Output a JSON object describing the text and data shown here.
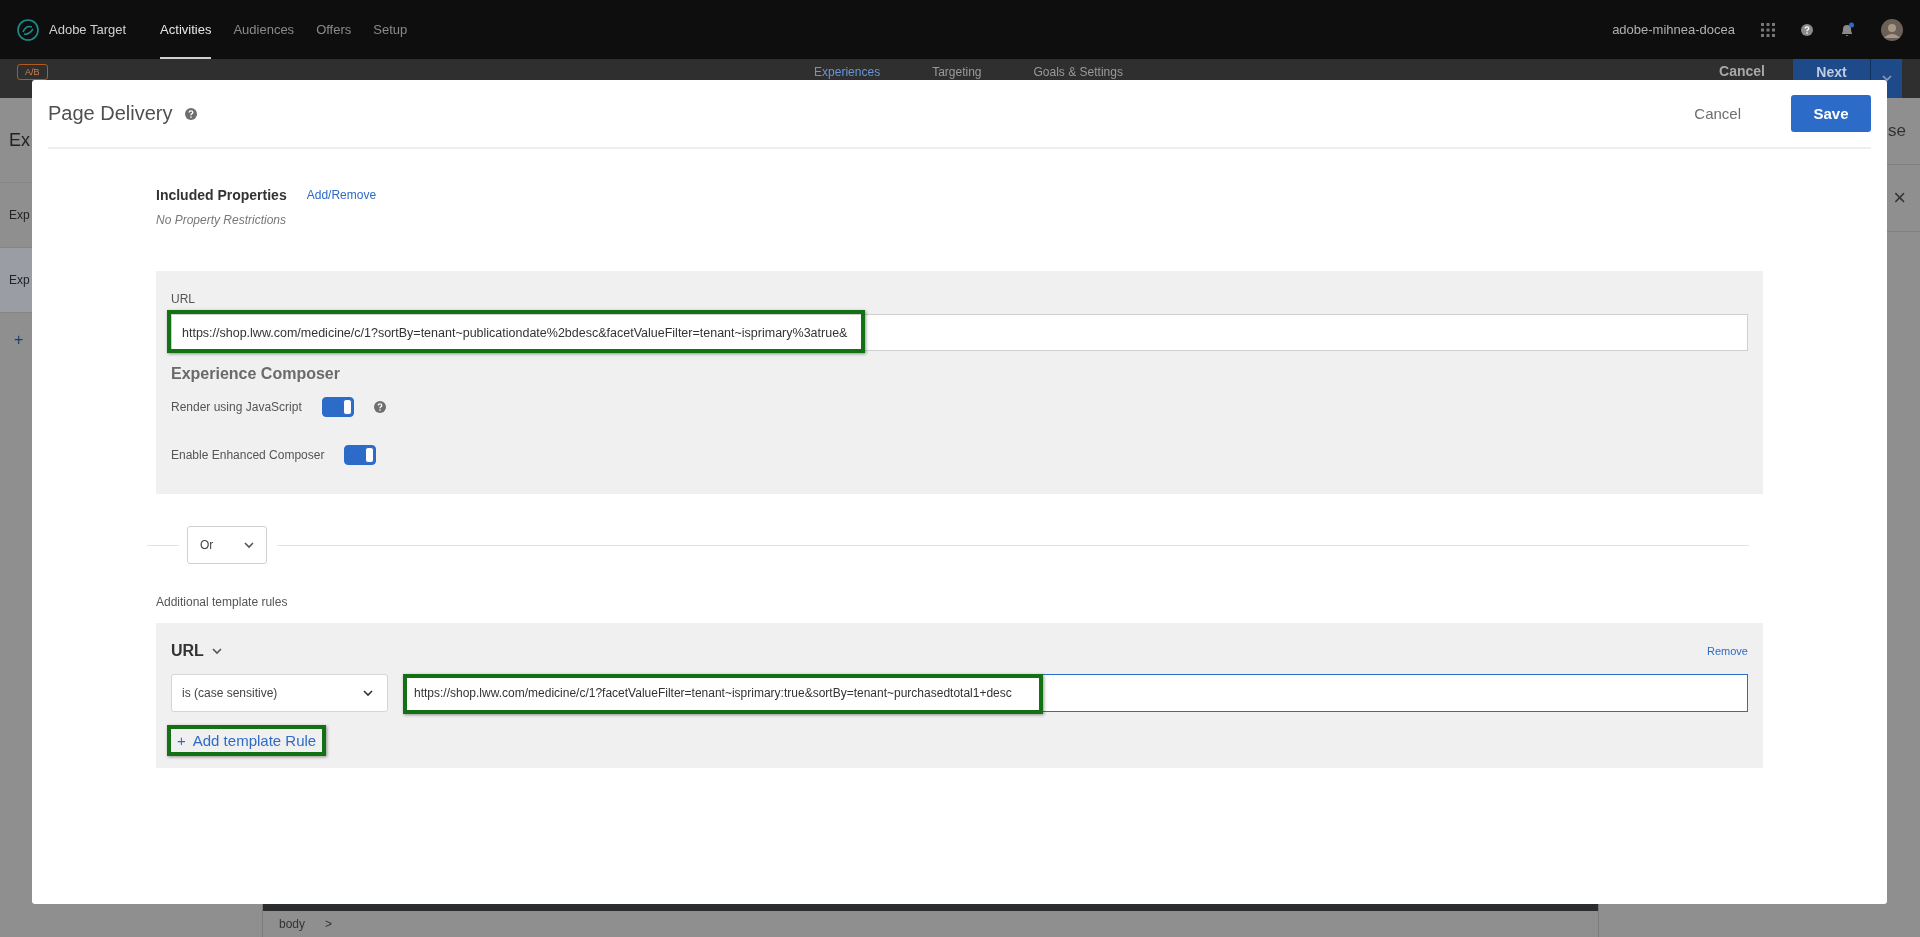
{
  "app_bar": {
    "product": "Adobe Target",
    "nav": [
      {
        "label": "Activities",
        "selected": true
      },
      {
        "label": "Audiences",
        "selected": false
      },
      {
        "label": "Offers",
        "selected": false
      },
      {
        "label": "Setup",
        "selected": false
      }
    ],
    "user": "adobe-mihnea-docea"
  },
  "activity_bar": {
    "badge": "A/B",
    "steps": [
      {
        "label": "Experiences",
        "selected": true
      },
      {
        "label": "Targeting",
        "selected": false
      },
      {
        "label": "Goals & Settings",
        "selected": false
      }
    ],
    "cancel": "Cancel",
    "next": "Next"
  },
  "background": {
    "left_items": [
      {
        "label": "Ex",
        "selected": false
      },
      {
        "label": "Exp",
        "selected": false
      },
      {
        "label": "Exp",
        "selected": true
      }
    ],
    "add": "+",
    "right_text": "se",
    "close": "×",
    "breadcrumb": [
      "body",
      ">"
    ]
  },
  "dialog": {
    "title": "Page Delivery",
    "cancel": "Cancel",
    "save": "Save",
    "included_properties": {
      "label": "Included Properties",
      "link": "Add/Remove",
      "note": "No Property Restrictions"
    },
    "url_panel": {
      "label": "URL",
      "value": "https://shop.lww.com/medicine/c/1?sortBy=tenant~publicationdate%2bdesc&facetValueFilter=tenant~isprimary%3atrue&",
      "highlighted": true,
      "composer_title": "Experience Composer",
      "options": [
        {
          "label": "Render using JavaScript",
          "on": true,
          "help": true
        },
        {
          "label": "Enable Enhanced Composer",
          "on": true,
          "help": false
        }
      ]
    },
    "operator": "Or",
    "additional_label": "Additional template rules",
    "rules": [
      {
        "field": "URL",
        "remove": "Remove",
        "operator": "is (case sensitive)",
        "value": "https://shop.lww.com/medicine/c/1?facetValueFilter=tenant~isprimary:true&sortBy=tenant~purchasedtotal1+desc",
        "highlighted": true
      }
    ],
    "add_rule": {
      "icon": "+",
      "label": "Add template Rule",
      "highlighted": true
    }
  }
}
